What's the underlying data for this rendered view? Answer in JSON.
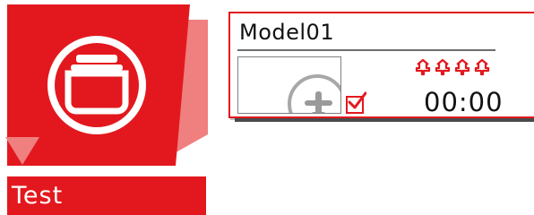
{
  "tile": {
    "label": "Test",
    "icon": "model-folder-icon",
    "colors": {
      "primary": "#e3181e",
      "secondary": "#f07f7f",
      "text": "#ffffff"
    }
  },
  "model_card": {
    "name": "Model01",
    "image_icon": "airplane-model-icon",
    "selected": true,
    "receivers": {
      "icon": "receiver-icon",
      "count": 4
    },
    "timer": "00:00",
    "accent_color": "#e3181e"
  }
}
